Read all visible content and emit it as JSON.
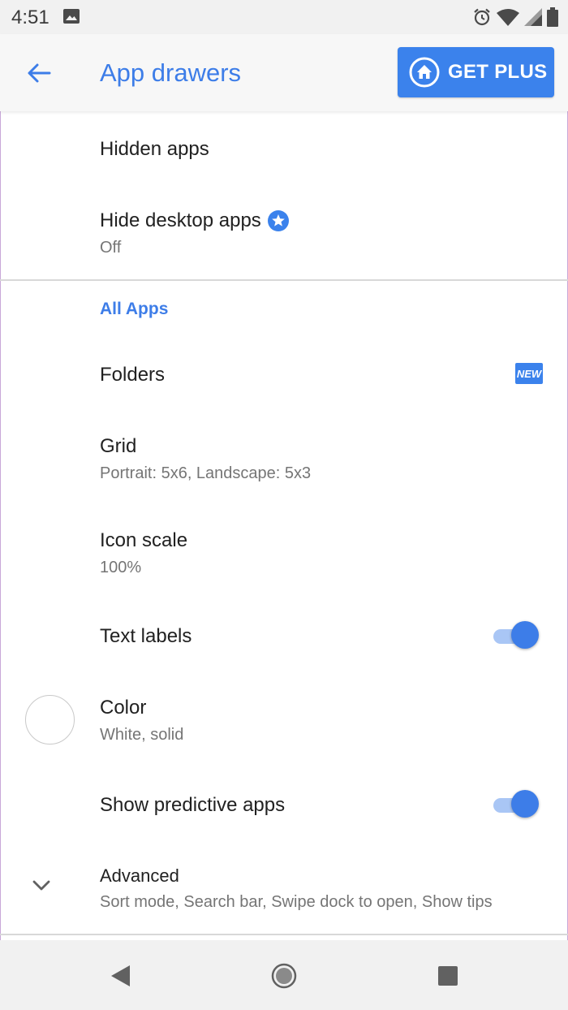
{
  "status_bar": {
    "time": "4:51"
  },
  "app_bar": {
    "title": "App drawers",
    "get_plus_label": "GET PLUS"
  },
  "settings": {
    "hidden_apps": {
      "title": "Hidden apps"
    },
    "hide_desktop_apps": {
      "title": "Hide desktop apps",
      "value": "Off"
    },
    "section_all_apps": "All Apps",
    "folders": {
      "title": "Folders",
      "badge": "NEW"
    },
    "grid": {
      "title": "Grid",
      "value": "Portrait: 5x6, Landscape: 5x3"
    },
    "icon_scale": {
      "title": "Icon scale",
      "value": "100%"
    },
    "text_labels": {
      "title": "Text labels",
      "enabled": true
    },
    "color": {
      "title": "Color",
      "value": "White, solid"
    },
    "show_predictive_apps": {
      "title": "Show predictive apps",
      "enabled": true
    },
    "advanced": {
      "title": "Advanced",
      "value": "Sort mode, Search bar, Swipe dock to open, Show tips"
    }
  },
  "colors": {
    "accent": "#3d7de8",
    "button": "#3b82ec",
    "switch_track": "#a9c6f5"
  },
  "icons": {
    "back": "arrow-back-icon",
    "plus_home": "home-icon",
    "premium": "star-badge-icon",
    "expand": "chevron-down-icon",
    "nav_back": "triangle-back-icon",
    "nav_home": "circle-home-icon",
    "nav_recents": "square-recents-icon"
  }
}
